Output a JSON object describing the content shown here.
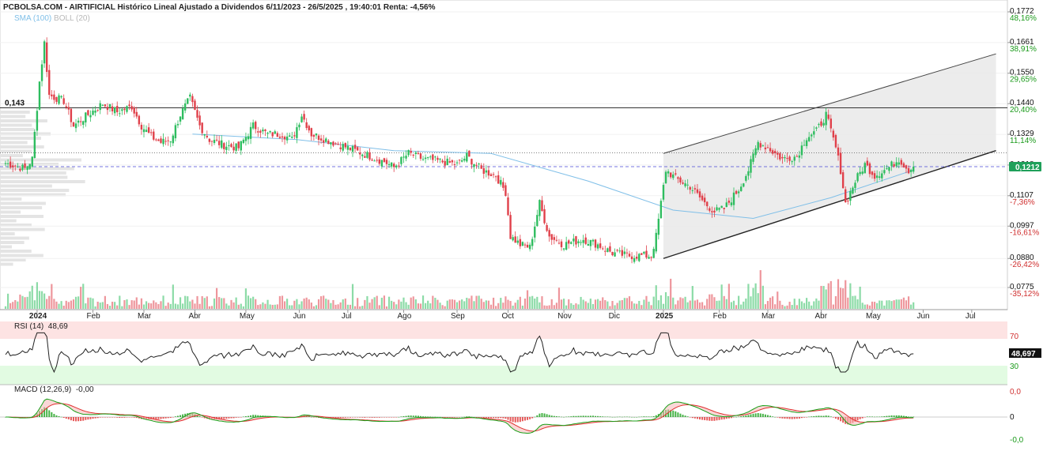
{
  "header": {
    "title": "PCBOLSA.COM - AIRTIFICIAL Histórico Lineal Ajustado a Dividendos 6/11/2023 - 26/5/2025 , 19:40:01 Renta: -4,56%",
    "sma_label": "SMA (100)",
    "boll_label": "BOLL (20)"
  },
  "colors": {
    "up": "#2ebd5f",
    "down": "#e0404a",
    "sma": "#7fbfe8",
    "channel_fill": "#e9e9e9",
    "current_price": "#1fa05a",
    "rsi_upper_zone": "#fde3e3",
    "rsi_lower_zone": "#e2fbe2",
    "macd_fast": "#18a018",
    "macd_slow": "#e03030"
  },
  "price_axis": {
    "ticks": [
      {
        "value": 0.1772,
        "label": "0,1772",
        "pct": "48,16%"
      },
      {
        "value": 0.1661,
        "label": "0,1661",
        "pct": "38,91%"
      },
      {
        "value": 0.155,
        "label": "0,1550",
        "pct": "29,65%"
      },
      {
        "value": 0.144,
        "label": "0,1440",
        "pct": "20,40%"
      },
      {
        "value": 0.1329,
        "label": "0,1329",
        "pct": "11,14%"
      },
      {
        "value": 0.1218,
        "label": "0,1218",
        "pct": ""
      },
      {
        "value": 0.1107,
        "label": "0,1107",
        "pct": "-7,36%"
      },
      {
        "value": 0.0997,
        "label": "0,0997",
        "pct": "-16,61%"
      },
      {
        "value": 0.088,
        "label": "0,0880",
        "pct": "-26,42%"
      },
      {
        "value": 0.0775,
        "label": "0,0775",
        "pct": "-35,12%"
      }
    ],
    "current_price": "0,1212",
    "current_value": 0.1212,
    "reference_level_label": "0,143",
    "reference_level": 0.1425,
    "dotted_level": 0.1262
  },
  "x_axis": {
    "labels": [
      {
        "label": "2024",
        "bold": true,
        "index": 13
      },
      {
        "label": "Feb",
        "bold": false,
        "index": 36
      },
      {
        "label": "Mar",
        "bold": false,
        "index": 57
      },
      {
        "label": "Abr",
        "bold": false,
        "index": 78
      },
      {
        "label": "May",
        "bold": false,
        "index": 99
      },
      {
        "label": "Jun",
        "bold": false,
        "index": 121
      },
      {
        "label": "Jul",
        "bold": false,
        "index": 141
      },
      {
        "label": "Ago",
        "bold": false,
        "index": 164
      },
      {
        "label": "Sep",
        "bold": false,
        "index": 186
      },
      {
        "label": "Oct",
        "bold": false,
        "index": 207
      },
      {
        "label": "Nov",
        "bold": false,
        "index": 230
      },
      {
        "label": "Dic",
        "bold": false,
        "index": 251
      },
      {
        "label": "2025",
        "bold": true,
        "index": 271
      },
      {
        "label": "Feb",
        "bold": false,
        "index": 294
      },
      {
        "label": "Mar",
        "bold": false,
        "index": 314
      },
      {
        "label": "Abr",
        "bold": false,
        "index": 336
      },
      {
        "label": "May",
        "bold": false,
        "index": 357
      },
      {
        "label": "Jun",
        "bold": false,
        "index": 378
      },
      {
        "label": "Jul",
        "bold": false,
        "index": 398
      }
    ]
  },
  "rsi": {
    "label": "RSI (14)",
    "value_label": "48,69",
    "current_value": "48,697",
    "upper": "70",
    "lower": "30"
  },
  "macd": {
    "label": "MACD (12,26,9)",
    "value_label": "-0,00",
    "ticks": {
      "top": "0,0",
      "mid": "0",
      "bottom": "-0,0"
    }
  },
  "chart_data": {
    "type": "line",
    "series_kind": "candlestick",
    "anchors": [
      [
        0,
        0.1225
      ],
      [
        8,
        0.1205
      ],
      [
        11,
        0.124
      ],
      [
        14,
        0.152
      ],
      [
        16,
        0.166
      ],
      [
        18,
        0.147
      ],
      [
        24,
        0.145
      ],
      [
        28,
        0.136
      ],
      [
        34,
        0.14
      ],
      [
        40,
        0.144
      ],
      [
        46,
        0.141
      ],
      [
        52,
        0.143
      ],
      [
        56,
        0.136
      ],
      [
        60,
        0.132
      ],
      [
        64,
        0.13
      ],
      [
        68,
        0.131
      ],
      [
        72,
        0.14
      ],
      [
        76,
        0.146
      ],
      [
        80,
        0.136
      ],
      [
        84,
        0.131
      ],
      [
        90,
        0.129
      ],
      [
        96,
        0.128
      ],
      [
        102,
        0.136
      ],
      [
        108,
        0.133
      ],
      [
        114,
        0.133
      ],
      [
        118,
        0.131
      ],
      [
        122,
        0.14
      ],
      [
        126,
        0.133
      ],
      [
        132,
        0.131
      ],
      [
        138,
        0.129
      ],
      [
        144,
        0.127
      ],
      [
        150,
        0.125
      ],
      [
        156,
        0.123
      ],
      [
        160,
        0.121
      ],
      [
        166,
        0.126
      ],
      [
        172,
        0.124
      ],
      [
        180,
        0.123
      ],
      [
        186,
        0.122
      ],
      [
        190,
        0.125
      ],
      [
        196,
        0.12
      ],
      [
        202,
        0.118
      ],
      [
        206,
        0.112
      ],
      [
        208,
        0.096
      ],
      [
        212,
        0.093
      ],
      [
        216,
        0.092
      ],
      [
        220,
        0.108
      ],
      [
        224,
        0.096
      ],
      [
        230,
        0.093
      ],
      [
        238,
        0.095
      ],
      [
        244,
        0.093
      ],
      [
        250,
        0.09
      ],
      [
        256,
        0.089
      ],
      [
        262,
        0.089
      ],
      [
        266,
        0.089
      ],
      [
        268,
        0.096
      ],
      [
        270,
        0.108
      ],
      [
        272,
        0.12
      ],
      [
        276,
        0.117
      ],
      [
        282,
        0.114
      ],
      [
        288,
        0.108
      ],
      [
        292,
        0.105
      ],
      [
        296,
        0.106
      ],
      [
        302,
        0.113
      ],
      [
        306,
        0.12
      ],
      [
        310,
        0.13
      ],
      [
        314,
        0.128
      ],
      [
        320,
        0.124
      ],
      [
        326,
        0.125
      ],
      [
        330,
        0.132
      ],
      [
        334,
        0.134
      ],
      [
        338,
        0.14
      ],
      [
        342,
        0.128
      ],
      [
        344,
        0.12
      ],
      [
        346,
        0.108
      ],
      [
        350,
        0.116
      ],
      [
        354,
        0.122
      ],
      [
        358,
        0.118
      ],
      [
        364,
        0.121
      ],
      [
        368,
        0.124
      ],
      [
        372,
        0.12
      ],
      [
        374,
        0.1212
      ]
    ],
    "channel": {
      "upper": [
        [
          271,
          0.126
        ],
        [
          408,
          0.162
        ]
      ],
      "lower": [
        [
          271,
          0.088
        ],
        [
          408,
          0.127
        ]
      ]
    },
    "sma100": [
      [
        77,
        0.133
      ],
      [
        120,
        0.131
      ],
      [
        160,
        0.127
      ],
      [
        200,
        0.126
      ],
      [
        240,
        0.116
      ],
      [
        275,
        0.1055
      ],
      [
        308,
        0.1025
      ],
      [
        340,
        0.11
      ],
      [
        374,
        0.12
      ]
    ]
  }
}
